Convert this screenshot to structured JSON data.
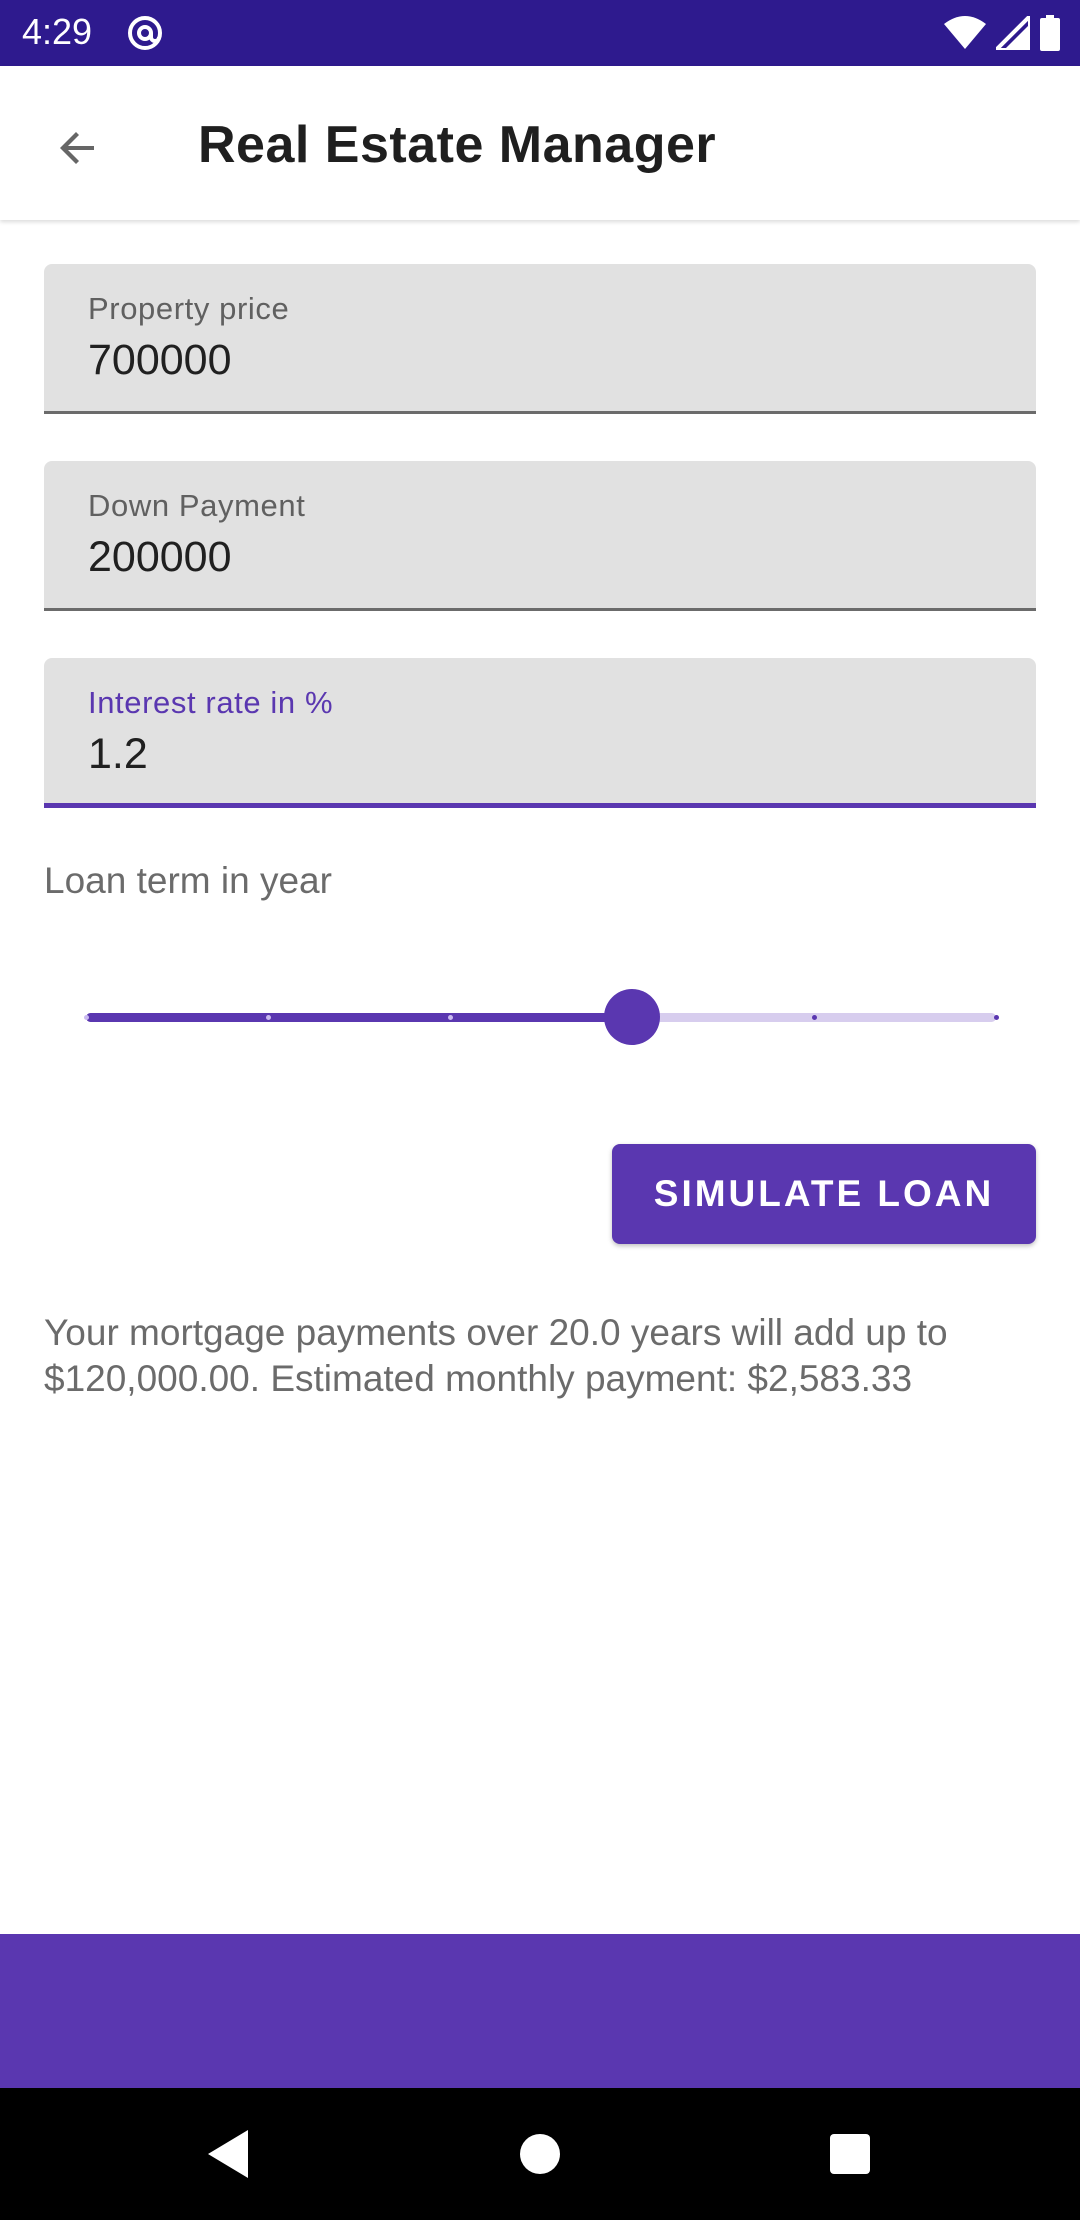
{
  "status_bar": {
    "time": "4:29",
    "notification_icon": "at-sign-icon",
    "icons": [
      "wifi-icon",
      "signal-icon",
      "battery-icon"
    ]
  },
  "app_bar": {
    "title": "Real Estate Manager",
    "back_icon": "arrow-back-icon"
  },
  "form": {
    "property_price": {
      "label": "Property price",
      "value": "700000"
    },
    "down_payment": {
      "label": "Down Payment",
      "value": "200000"
    },
    "interest_rate": {
      "label": "Interest rate in %",
      "value": "1.2",
      "focused": true
    },
    "loan_term": {
      "label": "Loan term in year",
      "slider_fraction": 0.6,
      "step_count": 5
    }
  },
  "actions": {
    "simulate_label": "SIMULATE LOAN"
  },
  "result": {
    "text": "Your mortgage payments over 20.0 years will add up to $120,000.00. Estimated monthly payment: $2,583.33"
  },
  "colors": {
    "status_bar": "#2e1a8e",
    "accent": "#5a37b0",
    "field_bg": "#e1e1e1",
    "slider_inactive": "#d7cdee"
  },
  "nav": {
    "back_icon": "nav-back-icon",
    "home_icon": "nav-home-icon",
    "recents_icon": "nav-recents-icon"
  }
}
